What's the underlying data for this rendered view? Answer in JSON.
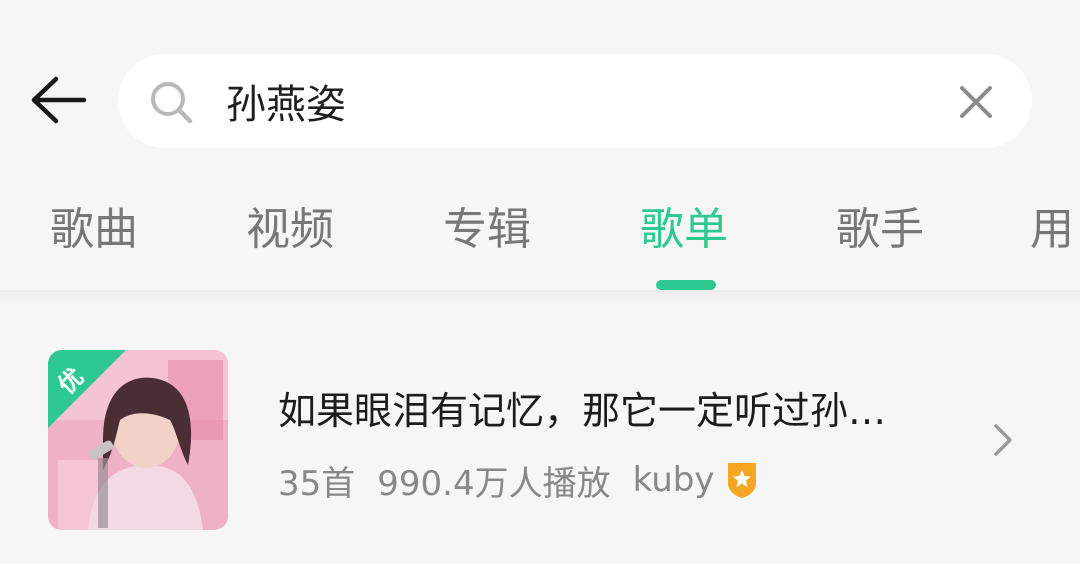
{
  "search": {
    "query": "孙燕姿"
  },
  "tabs": [
    {
      "label": "歌曲",
      "active": false
    },
    {
      "label": "视频",
      "active": false
    },
    {
      "label": "专辑",
      "active": false
    },
    {
      "label": "歌单",
      "active": true
    },
    {
      "label": "歌手",
      "active": false
    },
    {
      "label": "用",
      "active": false
    }
  ],
  "result": {
    "badge": "优",
    "title": "如果眼泪有记忆，那它一定听过孙…",
    "song_count": "35首",
    "plays": "990.4万人播放",
    "owner": "kuby"
  },
  "colors": {
    "accent": "#2ec990",
    "badge_orange": "#f5a623"
  },
  "icons": {
    "back": "arrow-left-icon",
    "search": "search-icon",
    "clear": "close-icon",
    "chevron": "chevron-right-icon",
    "vip": "vip-shield-icon"
  }
}
